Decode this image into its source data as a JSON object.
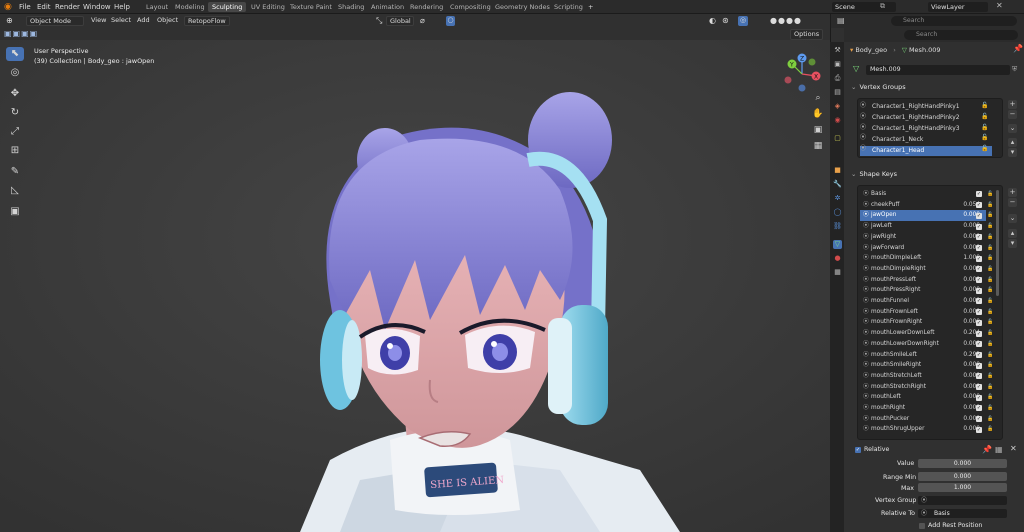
{
  "menu": [
    "File",
    "Edit",
    "Render",
    "Window",
    "Help"
  ],
  "workspaces": [
    "Layout",
    "Modeling",
    "Sculpting",
    "UV Editing",
    "Texture Paint",
    "Shading",
    "Animation",
    "Rendering",
    "Compositing",
    "Geometry Nodes",
    "Scripting"
  ],
  "active_workspace": "Sculpting",
  "add_tab": "+",
  "scene": "Scene",
  "view_layer": "ViewLayer",
  "header": {
    "mode": "Object Mode",
    "view": "View",
    "select": "Select",
    "add": "Add",
    "object": "Object",
    "addon": "RetopoFlow",
    "transform": "Global",
    "options": "Options"
  },
  "viewport": {
    "perspective": "User Perspective",
    "collection_info": "(39) Collection | Body_geo : jawOpen",
    "shirt_text": "SHE IS ALIEN",
    "gizmo": {
      "x": "X",
      "y": "Y",
      "z": "Z"
    }
  },
  "properties": {
    "search_placeholder": "Search",
    "breadcrumb_object": "Body_geo",
    "breadcrumb_mesh": "Mesh.009",
    "mesh_name": "Mesh.009",
    "vertex_groups_title": "Vertex Groups",
    "vertex_groups": [
      "Character1_RightHandPinky1",
      "Character1_RightHandPinky2",
      "Character1_RightHandPinky3",
      "Character1_Neck",
      "Character1_Head"
    ],
    "shape_keys_title": "Shape Keys",
    "shape_keys": [
      {
        "name": "Basis",
        "value": ""
      },
      {
        "name": "cheekPuff",
        "value": "0.054"
      },
      {
        "name": "jawOpen",
        "value": "0.000"
      },
      {
        "name": "jawLeft",
        "value": "0.000"
      },
      {
        "name": "jawRight",
        "value": "0.000"
      },
      {
        "name": "jawForward",
        "value": "0.000"
      },
      {
        "name": "mouthDimpleLeft",
        "value": "1.000"
      },
      {
        "name": "mouthDimpleRight",
        "value": "0.000"
      },
      {
        "name": "mouthPressLeft",
        "value": "0.000"
      },
      {
        "name": "mouthPressRight",
        "value": "0.000"
      },
      {
        "name": "mouthFunnel",
        "value": "0.000"
      },
      {
        "name": "mouthFrownLeft",
        "value": "0.000"
      },
      {
        "name": "mouthFrownRight",
        "value": "0.000"
      },
      {
        "name": "mouthLowerDownLeft",
        "value": "0.204"
      },
      {
        "name": "mouthLowerDownRight",
        "value": "0.000"
      },
      {
        "name": "mouthSmileLeft",
        "value": "0.293"
      },
      {
        "name": "mouthSmileRight",
        "value": "0.000"
      },
      {
        "name": "mouthStretchLeft",
        "value": "0.000"
      },
      {
        "name": "mouthStretchRight",
        "value": "0.000"
      },
      {
        "name": "mouthLeft",
        "value": "0.000"
      },
      {
        "name": "mouthRight",
        "value": "0.000"
      },
      {
        "name": "mouthPucker",
        "value": "0.000"
      },
      {
        "name": "mouthShrugUpper",
        "value": "0.000"
      }
    ],
    "relative_label": "Relative",
    "value_label": "Value",
    "value": "0.000",
    "range_min_label": "Range Min",
    "range_min": "0.000",
    "max_label": "Max",
    "max": "1.000",
    "vertex_group_label": "Vertex Group",
    "relative_to_label": "Relative To",
    "relative_to": "Basis",
    "add_rest_position": "Add Rest Position"
  },
  "colors": {
    "accent": "#4772b3",
    "hair": "#8e8ad8",
    "headphone": "#6ec3e0"
  }
}
